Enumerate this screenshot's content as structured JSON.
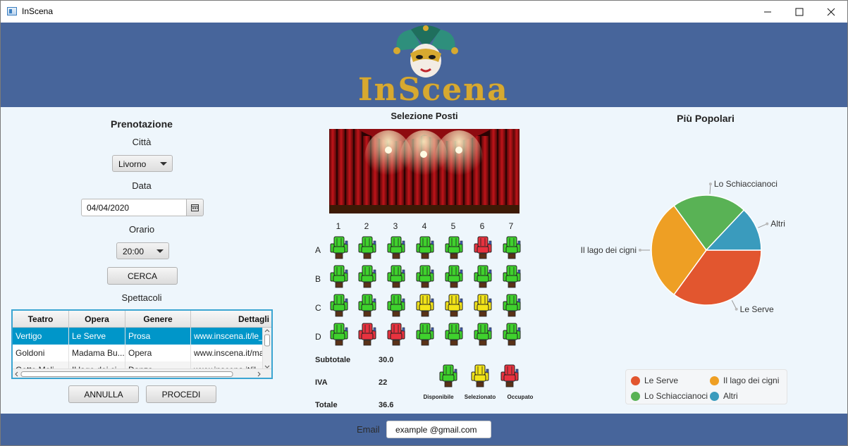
{
  "window": {
    "title": "InScena"
  },
  "header": {
    "brand": "InScena"
  },
  "booking": {
    "title": "Prenotazione",
    "city_label": "Città",
    "city_value": "Livorno",
    "date_label": "Data",
    "date_value": "04/04/2020",
    "time_label": "Orario",
    "time_value": "20:00",
    "search_button": "CERCA",
    "shows_label": "Spettacoli",
    "columns": [
      "Teatro",
      "Opera",
      "Genere",
      "Dettagli"
    ],
    "rows": [
      [
        "Vertigo",
        "Le Serve",
        "Prosa",
        "www.inscena.it/le_s"
      ],
      [
        "Goldoni",
        "Madama Bu...",
        "Opera",
        "www.inscena.it/ma"
      ],
      [
        "Gotto Moli",
        "Il lago dei ci...",
        "Danza",
        "www.inscena.it/il"
      ]
    ],
    "selected_row": 0,
    "cancel_button": "ANNULLA",
    "proceed_button": "PROCEDI"
  },
  "seats": {
    "title": "Selezione Posti",
    "columns": [
      "1",
      "2",
      "3",
      "4",
      "5",
      "6",
      "7"
    ],
    "rows": [
      "A",
      "B",
      "C",
      "D"
    ],
    "status": [
      [
        "free",
        "free",
        "free",
        "free",
        "free",
        "occupied",
        "free"
      ],
      [
        "free",
        "free",
        "free",
        "free",
        "free",
        "free",
        "free"
      ],
      [
        "free",
        "free",
        "free",
        "selected",
        "selected",
        "selected",
        "free"
      ],
      [
        "free",
        "occupied",
        "occupied",
        "free",
        "free",
        "free",
        "free"
      ]
    ],
    "colors": {
      "free": "#3fd22d",
      "selected": "#f2e418",
      "occupied": "#e8323f"
    },
    "subtotal_label": "Subtotale",
    "subtotal_value": "30.0",
    "vat_label": "IVA",
    "vat_value": "22",
    "total_label": "Totale",
    "total_value": "36.6",
    "legend": {
      "free": "Disponibile",
      "selected": "Selezionato",
      "occupied": "Occupato"
    }
  },
  "popular": {
    "title": "Più Popolari",
    "chart_data": {
      "type": "pie",
      "labels": [
        "Le Serve",
        "Il lago dei cigni",
        "Lo Schiaccianoci",
        "Altri"
      ],
      "values": [
        35,
        30,
        22,
        13
      ],
      "colors": [
        "#e2562f",
        "#ee9f24",
        "#59b255",
        "#3a9bbd"
      ],
      "legend_position": "bottom"
    }
  },
  "footer": {
    "email_label": "Email",
    "email_value": "example  @gmail.com"
  }
}
